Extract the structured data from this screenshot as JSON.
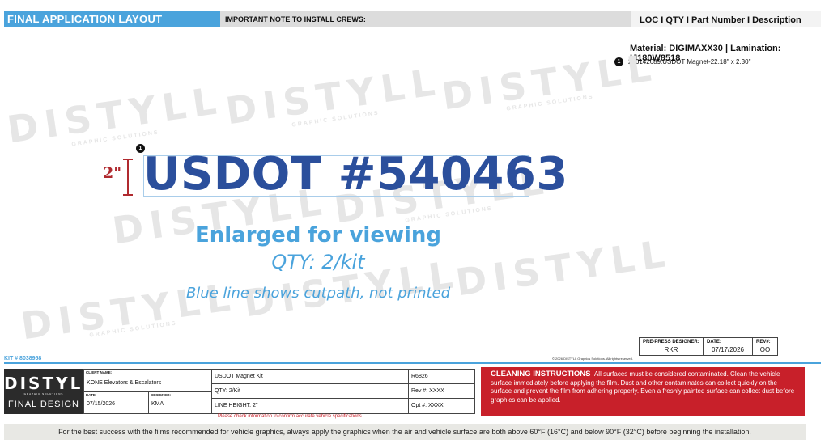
{
  "header": {
    "title": "FINAL APPLICATION LAYOUT",
    "note": "IMPORTANT NOTE TO INSTALL CREWS:",
    "loc_columns": "LOC I QTY I Part Number I Description"
  },
  "material_line": "Material: DIGIMAXX30 | Lamination: IJ180W8518",
  "parts": [
    {
      "marker": "1",
      "description": "2: 6142689.USDOT Magnet-22.18\" x 2.30\""
    }
  ],
  "watermark": {
    "brand": "DISTYLL",
    "sub": "GRAPHIC SOLUTIONS"
  },
  "decal": {
    "marker": "1",
    "text": "USDOT #540463",
    "height_label": "2\"",
    "text_color": "#2b4f9c"
  },
  "notes": {
    "enlarged": "Enlarged for viewing",
    "qty": "QTY: 2/kit",
    "cutpath": "Blue line shows cutpath, not printed"
  },
  "kit_number": "KIT # 8038958",
  "copyright": "© 2026 DISTYLL Graphics Solutions. All rights reserved.",
  "prepress": {
    "designer_label": "PRE-PRESS DESIGNER:",
    "designer_value": "RKR",
    "date_label": "DATE:",
    "date_value": "07/17/2026",
    "rev_label": "REV#:",
    "rev_value": "OO"
  },
  "title_block": {
    "logo": "DISTYLL",
    "logo_sub": "GRAPHIC SOLUTIONS",
    "final_design": "FINAL DESIGN",
    "client_label": "CLIENT NAME:",
    "client_value": "KONE Elevators & Escalators",
    "date_label": "DATE:",
    "date_value": "07/15/2026",
    "designer_label": "DESIGNER:",
    "designer_value": "KMA",
    "item": "USDOT Magnet Kit",
    "qty": "QTY: 2/Kit",
    "line_height": "LINE HEIGHT: 2\"",
    "job": "R6826",
    "rev": "Rev #:  XXXX",
    "opt": "Opt #:  XXXX"
  },
  "check_note": "Please check information to confirm accurate vehicle specifications.",
  "cleaning": {
    "title": "CLEANING INSTRUCTIONS",
    "body": "All surfaces must be considered contaminated. Clean the vehicle surface immediately before applying the film. Dust and other contaminates can collect quickly on the surface and prevent the film from adhering properly. Even a freshly painted surface can collect dust before graphics can be applied.",
    "bg_color": "#c8202a"
  },
  "footer_note": "For the best success with the films recommended for vehicle graphics, always apply the graphics when the air and vehicle surface are both above 60°F (16°C) and below 90°F (32°C) before beginning the installation.",
  "colors": {
    "accent": "#4aa3dc",
    "dimension": "#b02a2f"
  }
}
